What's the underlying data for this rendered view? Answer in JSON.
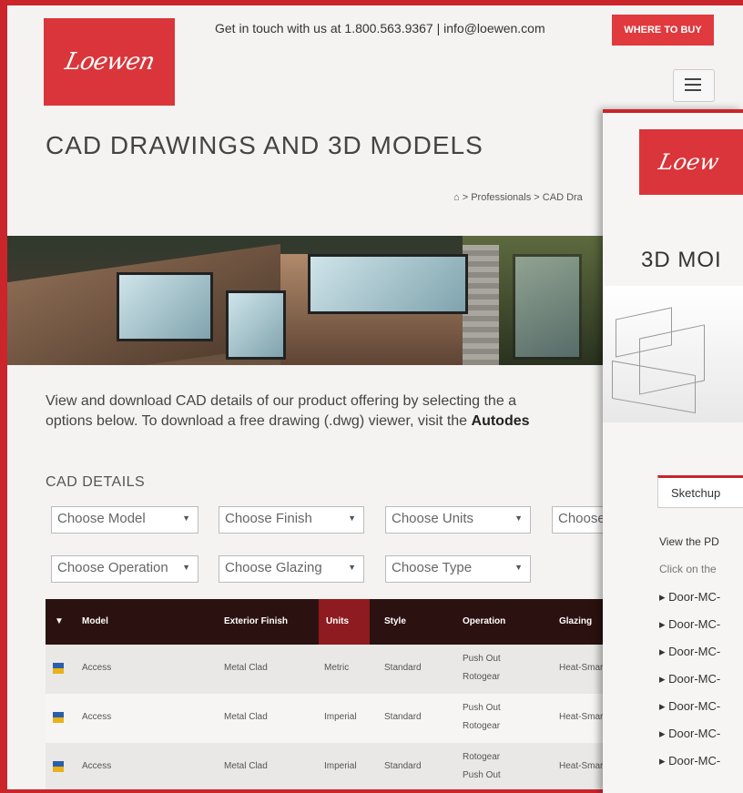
{
  "brand": {
    "logo_text": "Loewen",
    "accent": "#c9252b"
  },
  "header": {
    "contact": "Get in touch with us at 1.800.563.9367 | info@loewen.com",
    "where_to_buy": "WHERE TO BUY",
    "menu_icon": "hamburger-icon"
  },
  "page": {
    "title": "CAD DRAWINGS AND 3D MODELS",
    "breadcrumb": {
      "home_icon": "home-icon",
      "items": [
        "Professionals",
        "CAD Dra"
      ]
    },
    "intro_line1": "View and download CAD details of our product offering by selecting the a",
    "intro_line2_prefix": "options below. To download a free drawing (.dwg) viewer, visit the ",
    "intro_line2_bold": "Autodes"
  },
  "cad": {
    "heading": "CAD DETAILS",
    "filters": {
      "model": "Choose Model",
      "finish": "Choose Finish",
      "units": "Choose Units",
      "fourth": "Choose",
      "operation": "Choose Operation",
      "glazing": "Choose Glazing",
      "type": "Choose Type"
    },
    "columns": [
      "Model",
      "Exterior Finish",
      "Units",
      "Style",
      "Operation",
      "Glazing"
    ],
    "rows": [
      {
        "model": "Access",
        "finish": "Metal Clad",
        "units": "Metric",
        "style": "Standard",
        "op1": "Push Out",
        "op2": "Rotogear",
        "glazing": "Heat-Smart"
      },
      {
        "model": "Access",
        "finish": "Metal Clad",
        "units": "Imperial",
        "style": "Standard",
        "op1": "Push Out",
        "op2": "Rotogear",
        "glazing": "Heat-Smart"
      },
      {
        "model": "Access",
        "finish": "Metal Clad",
        "units": "Imperial",
        "style": "Standard",
        "op1": "Rotogear",
        "op2": "Push Out",
        "glazing": "Heat-Smart"
      }
    ]
  },
  "overlay": {
    "logo_text": "Loew",
    "title": "3D MOI",
    "tab": "Sketchup",
    "line1": "View the PD",
    "line2": "Click on the",
    "downloads": [
      "Door-MC-",
      "Door-MC-",
      "Door-MC-",
      "Door-MC-",
      "Door-MC-",
      "Door-MC-",
      "Door-MC-"
    ]
  }
}
